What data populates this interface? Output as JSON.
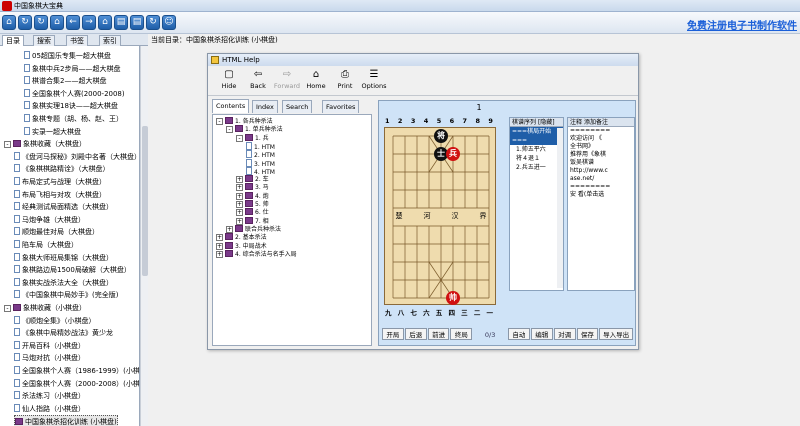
{
  "app": {
    "title": "中国象棋大宝典",
    "promo": "免费注册电子书制作软件"
  },
  "toolbar": {
    "icons": [
      "home-icon",
      "refresh-icon",
      "refresh-icon",
      "home-icon",
      "back-icon",
      "forward-icon",
      "home-icon",
      "book-icon",
      "book-icon",
      "refresh-icon",
      "smile-icon"
    ]
  },
  "left_tabs": [
    "目录",
    "搜索",
    "书签",
    "索引"
  ],
  "current_path": {
    "label": "当前目录：",
    "value": "中国象棋杀招化训练 (小棋盘)"
  },
  "tree": [
    {
      "type": "page",
      "indent": 2,
      "label": "05超国乐专集一超大棋盘"
    },
    {
      "type": "page",
      "indent": 2,
      "label": "象棋中兵2步局——超大棋盘"
    },
    {
      "type": "page",
      "indent": 2,
      "label": "棋谱合集2——超大棋盘"
    },
    {
      "type": "page",
      "indent": 2,
      "label": "全国象棋个人赛(2000-2008)"
    },
    {
      "type": "page",
      "indent": 2,
      "label": "象棋实理18诀——超大棋盘"
    },
    {
      "type": "page",
      "indent": 2,
      "label": "象棋专题（胡、杨、赵、王）"
    },
    {
      "type": "page",
      "indent": 2,
      "label": "实录一超大棋盘"
    },
    {
      "type": "book",
      "indent": 0,
      "label": "象棋收藏（大棋盘）",
      "exp": "-"
    },
    {
      "type": "page",
      "indent": 1,
      "label": "《盘河马探秘》刘殿中名著（大棋盘）"
    },
    {
      "type": "page",
      "indent": 1,
      "label": "《象棋棋路精诠》（大棋盘）"
    },
    {
      "type": "page",
      "indent": 1,
      "label": "布局定式与战理（大棋盘）"
    },
    {
      "type": "page",
      "indent": 1,
      "label": "布局飞相与对攻（大棋盘）"
    },
    {
      "type": "page",
      "indent": 1,
      "label": "经典测试局面精选（大棋盘）"
    },
    {
      "type": "page",
      "indent": 1,
      "label": "马炮争雄（大棋盘）"
    },
    {
      "type": "page",
      "indent": 1,
      "label": "顺炮最佳对局（大棋盘）"
    },
    {
      "type": "page",
      "indent": 1,
      "label": "陷车局（大棋盘）"
    },
    {
      "type": "page",
      "indent": 1,
      "label": "象棋大师班局集锦（大棋盘）"
    },
    {
      "type": "page",
      "indent": 1,
      "label": "象棋路边局1500局破解（大棋盘）"
    },
    {
      "type": "page",
      "indent": 1,
      "label": "象棋实战杀法大全（大棋盘）"
    },
    {
      "type": "page",
      "indent": 1,
      "label": "《中国象棋中局妙手》(完全版)"
    },
    {
      "type": "book",
      "indent": 0,
      "label": "象棋收藏（小棋盘）",
      "exp": "-"
    },
    {
      "type": "page",
      "indent": 1,
      "label": "《顺炮全集》（小棋盘）"
    },
    {
      "type": "page",
      "indent": 1,
      "label": "《象棋中局精妙战法》黄少龙"
    },
    {
      "type": "page",
      "indent": 1,
      "label": "开局百科（小棋盘）"
    },
    {
      "type": "page",
      "indent": 1,
      "label": "马炮对抗（小棋盘）"
    },
    {
      "type": "page",
      "indent": 1,
      "label": "全国象棋个人赛（1986-1999）(小棋盘)"
    },
    {
      "type": "page",
      "indent": 1,
      "label": "全国象棋个人赛（2000-2008）(小棋盘)"
    },
    {
      "type": "page",
      "indent": 1,
      "label": "杀法练习（小棋盘）"
    },
    {
      "type": "page",
      "indent": 1,
      "label": "仙人指路（小棋盘）"
    },
    {
      "type": "book",
      "indent": 1,
      "label": "中国象棋杀招化训练 (小棋盘)",
      "selected": true
    }
  ],
  "htmlhelp": {
    "title": "HTML Help",
    "buttons": [
      {
        "label": "Hide",
        "icon": "▢",
        "disabled": false
      },
      {
        "label": "Back",
        "icon": "⇦",
        "disabled": false
      },
      {
        "label": "Forward",
        "icon": "⇨",
        "disabled": true
      },
      {
        "label": "Home",
        "icon": "⌂",
        "disabled": false
      },
      {
        "label": "Print",
        "icon": "⎙",
        "disabled": false
      },
      {
        "label": "Options",
        "icon": "☰",
        "disabled": false
      }
    ],
    "tabs": [
      "Contents",
      "Index",
      "Search",
      "Favorites"
    ],
    "contents": [
      {
        "indent": 0,
        "exp": "-",
        "type": "book",
        "label": "1. 各兵种杀法"
      },
      {
        "indent": 1,
        "exp": "-",
        "type": "book",
        "label": "1. 单兵种杀法"
      },
      {
        "indent": 2,
        "exp": "-",
        "type": "book",
        "label": "1. 兵"
      },
      {
        "indent": 3,
        "exp": "",
        "type": "page",
        "label": "1. HTM"
      },
      {
        "indent": 3,
        "exp": "",
        "type": "page",
        "label": "2. HTM"
      },
      {
        "indent": 3,
        "exp": "",
        "type": "page",
        "label": "3. HTM"
      },
      {
        "indent": 3,
        "exp": "",
        "type": "page",
        "label": "4. HTM"
      },
      {
        "indent": 2,
        "exp": "+",
        "type": "book",
        "label": "2. 车"
      },
      {
        "indent": 2,
        "exp": "+",
        "type": "book",
        "label": "3. 马"
      },
      {
        "indent": 2,
        "exp": "+",
        "type": "book",
        "label": "4. 炮"
      },
      {
        "indent": 2,
        "exp": "+",
        "type": "book",
        "label": "5. 帅"
      },
      {
        "indent": 2,
        "exp": "+",
        "type": "book",
        "label": "6. 仕"
      },
      {
        "indent": 2,
        "exp": "+",
        "type": "book",
        "label": "7. 相"
      },
      {
        "indent": 1,
        "exp": "+",
        "type": "book",
        "label": "联合兵种杀法"
      },
      {
        "indent": 0,
        "exp": "+",
        "type": "book",
        "label": "2. 基本杀法"
      },
      {
        "indent": 0,
        "exp": "+",
        "type": "book",
        "label": "3. 中局战术"
      },
      {
        "indent": 0,
        "exp": "+",
        "type": "book",
        "label": "4. 综合杀法与名手入局"
      }
    ],
    "board": {
      "title": "1",
      "top_files": [
        "1",
        "2",
        "3",
        "4",
        "5",
        "6",
        "7",
        "8",
        "9"
      ],
      "bottom_files": [
        "九",
        "八",
        "七",
        "六",
        "五",
        "四",
        "三",
        "二",
        "一"
      ],
      "river": [
        "楚",
        "河",
        "汉",
        "界"
      ],
      "pieces": [
        {
          "char": "将",
          "side": "black",
          "col": 4,
          "row": 0
        },
        {
          "char": "士",
          "side": "black",
          "col": 4,
          "row": 1
        },
        {
          "char": "兵",
          "side": "red",
          "col": 5,
          "row": 1
        },
        {
          "char": "帅",
          "side": "red",
          "col": 5,
          "row": 9
        }
      ]
    },
    "moves": {
      "header": "棋谱序列",
      "toggle": "[隐藏]",
      "start": "===棋局开始===",
      "items": [
        "1.帅五平六",
        "将４退１",
        "2.兵五进一"
      ]
    },
    "notes": {
      "tab1": "注释",
      "tab2": "添加备注",
      "lines": [
        "  ",
        "  ",
        "  ",
        "========",
        "  欢迎访问 《",
        "全书网》",
        "  推荐用《象棋",
        "饭吴棋谱",
        "http://www.c",
        "ase.net/",
        "  ",
        "  ",
        "  ",
        "========",
        "  ",
        "  ",
        "  ",
        "  ",
        "  ",
        "  ",
        "  ",
        "  ",
        "  ",
        "安 看(单击选"
      ]
    },
    "controls": [
      "开局",
      "后退",
      "前进",
      "终局",
      "0/3",
      "自动",
      "编辑",
      "对调",
      "保存",
      "导入导出"
    ]
  }
}
